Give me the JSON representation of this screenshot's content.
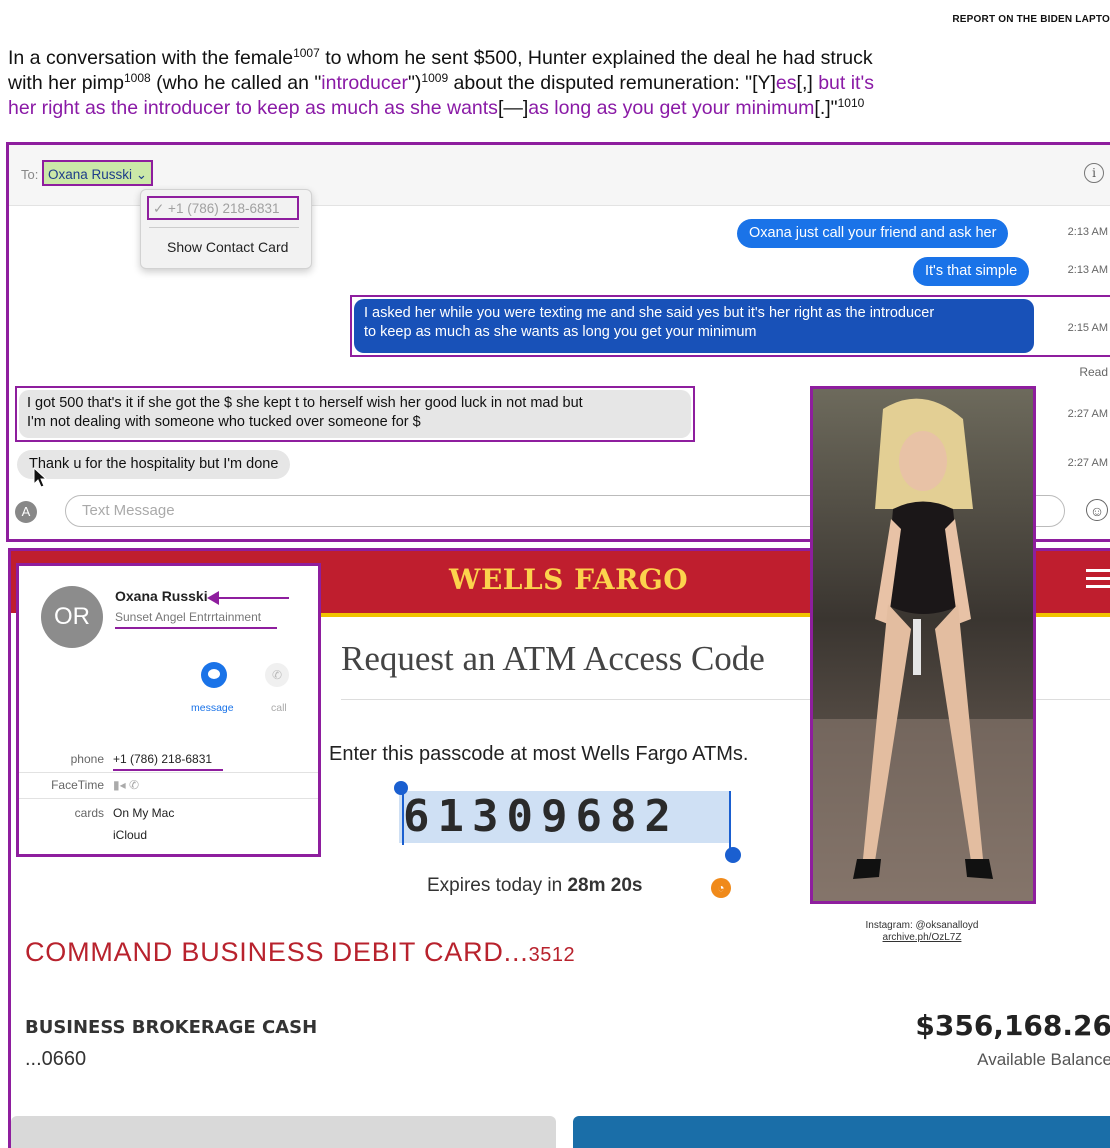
{
  "header": {
    "title": "REPORT ON THE BIDEN LAPTO"
  },
  "paragraph": {
    "l1a": "In a conversation with the female",
    "fn1007": "1007",
    "l1b": " to whom he sent $500, Hunter explained the deal he had struck",
    "l2a": "with her pimp",
    "fn1008": "1008",
    "l2b": " (who he called an \"",
    "introducer": "introducer",
    "l2c": "\")",
    "fn1009": "1009",
    "l2d": " about the disputed remuneration: \"[Y]",
    "es": "es",
    "l2e": "[,] ",
    "l2f": "but it's",
    "l3a": "her right as the introducer to keep as much as she wants",
    "l3b": "[—]",
    "l3c": "as long as you get your minimum",
    "l3d": "[.]\"",
    "fn1010": "1010"
  },
  "messages": {
    "to_label": "To:",
    "recipient": "Oxana Russki",
    "dropdown_phone": "✓ +1 (786) 218-6831",
    "dropdown_card": "Show Contact Card",
    "info_icon": "i",
    "m1": "Oxana just call your friend and ask her",
    "t1": "2:13 AM",
    "m2": "It's that simple",
    "t2": "2:13 AM",
    "m3_l1": "I asked her while you were texting me and she said yes but it's her right as the introducer",
    "m3_l2": "to keep as much as she wants as long you get your minimum",
    "t3": "2:15 AM",
    "read": "Read",
    "m4_l1": "I got 500 that's it if she got the $ she kept t to herself wish her good luck in not mad but",
    "m4_l2": "I'm not dealing with someone who tucked over someone for $",
    "t4": "2:27 AM",
    "m5": "Thank u for the hospitality but I'm done",
    "t5": "2:27 AM",
    "input_placeholder": "Text Message",
    "app_icon": "A",
    "emoji_icon": "☺"
  },
  "bank": {
    "brand": "WELLS FARGO",
    "heading": "Request an ATM Access Code",
    "instruction": "Enter this passcode at most Wells Fargo ATMs.",
    "passcode": "61309682",
    "expires_prefix": "Expires today in ",
    "expires_time": "28m 20s",
    "card_title": "COMMAND BUSINESS DEBIT CARD...",
    "card_last": "3512",
    "brokerage_title": "BUSINESS BROKERAGE CASH",
    "brokerage_num": "...0660",
    "balance": "$356,168.26",
    "balance_label": "Available Balance",
    "colors": {
      "brand_red": "#bf1e2e",
      "brand_gold": "#fcd34d"
    }
  },
  "contact": {
    "initials": "OR",
    "name": "Oxana Russki",
    "company": "Sunset Angel Entrrtainment",
    "message_label": "message",
    "call_label": "call",
    "phone_label": "phone",
    "phone": "+1 (786) 218-6831",
    "facetime_label": "FaceTime",
    "facetime_icons": "▮◂ ✆",
    "cards_label": "cards",
    "cards_value1": "On My Mac",
    "cards_value2": "iCloud"
  },
  "photo": {
    "caption_line1": "Instagram: @oksanalloyd",
    "caption_line2": "archive.ph/OzL7Z"
  },
  "colors": {
    "highlight": "#8e1e9e",
    "imessage_blue": "#1a73e8"
  }
}
